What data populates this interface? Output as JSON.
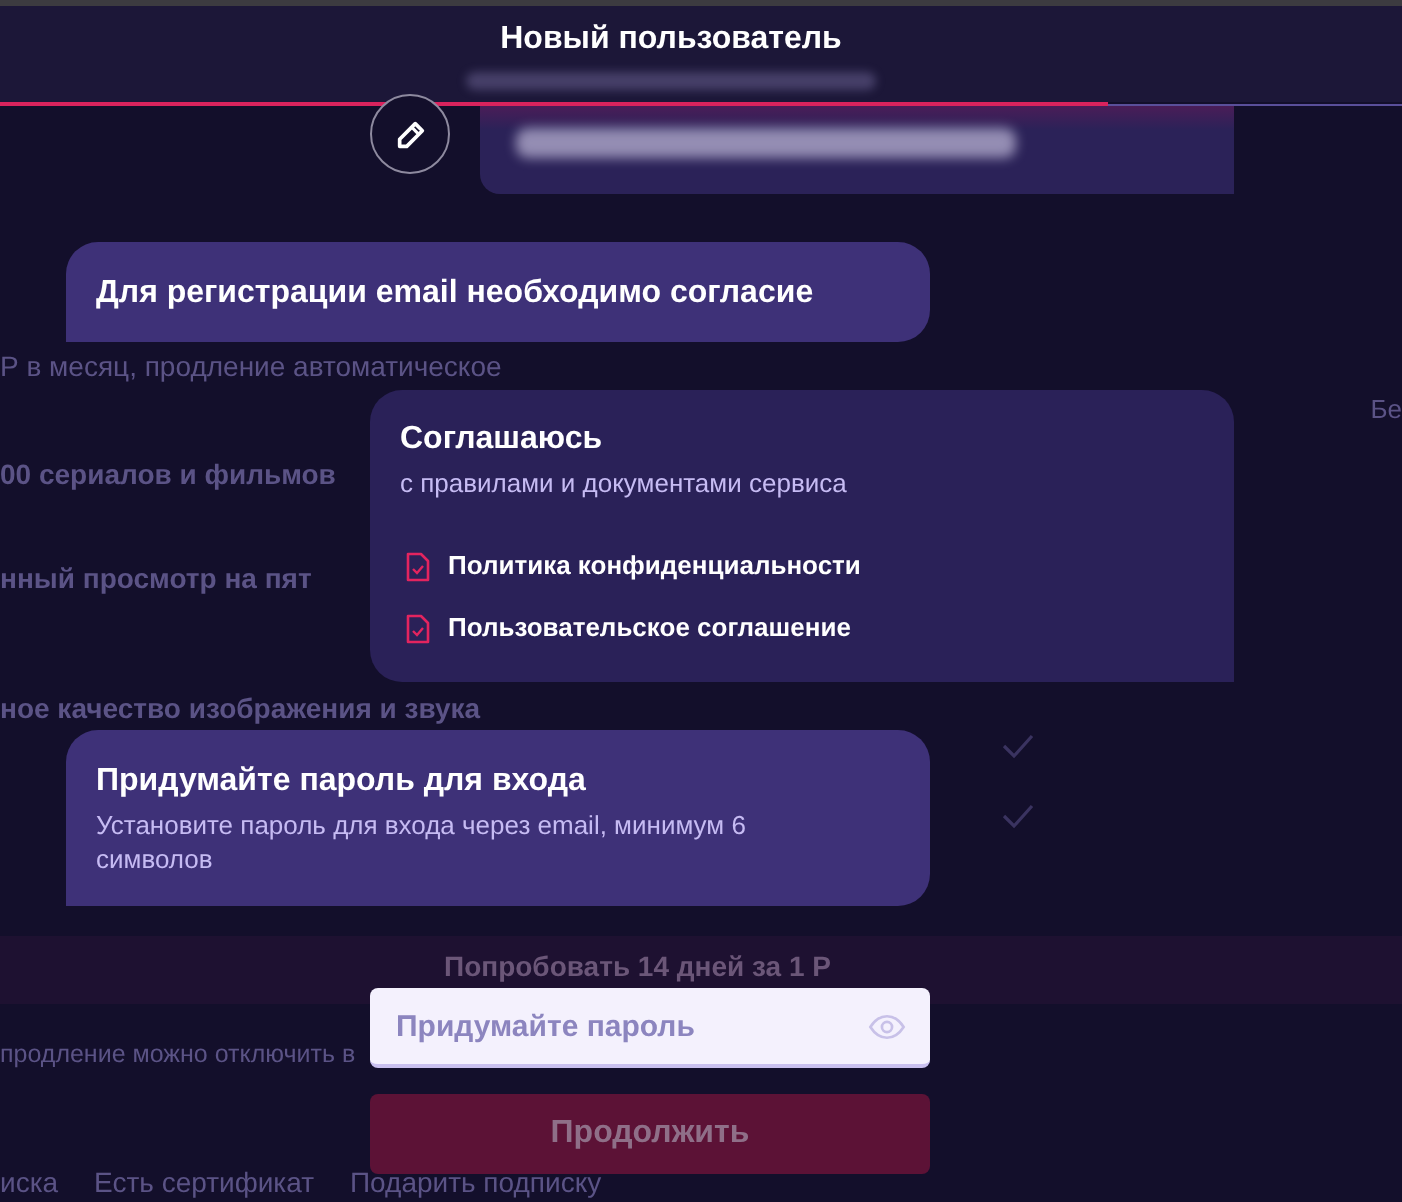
{
  "background_page": {
    "price_note": "Р в месяц, продление автоматическое",
    "column_heading": "Бе",
    "features": [
      "00 сериалов и фильмов",
      "нный просмотр на пят",
      "ное качество изображения и звука"
    ],
    "trial_button": "Попробовать 14 дней за 1 Р",
    "renewal_note": "продление можно отключить в",
    "footer_links": [
      "иска",
      "Есть сертификат",
      "Подарить подписку"
    ]
  },
  "dialog": {
    "title": "Новый пользователь",
    "progress": {
      "level": 0.79
    }
  },
  "messages": [
    {
      "kind": "email_answer"
    },
    {
      "kind": "prompt",
      "title": "Для регистрации email необходимо согласие"
    },
    {
      "kind": "consent",
      "title": "Соглашаюсь",
      "subtitle": "с правилами и документами сервиса",
      "links": [
        "Политика конфиденциальности",
        "Пользовательское соглашение"
      ]
    },
    {
      "kind": "prompt",
      "title": "Придумайте пароль для входа",
      "subtitle": "Установите пароль для входа через email, минимум 6 символов"
    }
  ],
  "password_field": {
    "placeholder": "Придумайте пароль"
  },
  "continue_button": {
    "label": "Продолжить",
    "disabled": true
  }
}
